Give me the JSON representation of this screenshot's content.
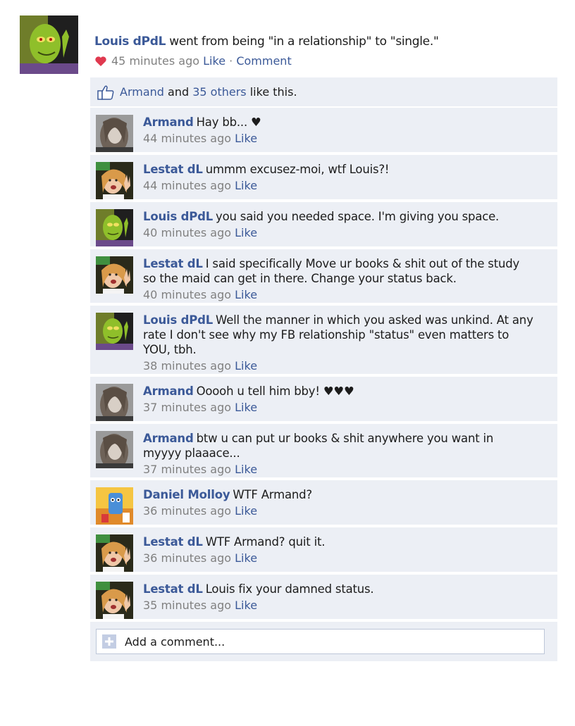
{
  "post": {
    "author": "Louis dPdL",
    "text": "went from being \"in a relationship\" to \"single.\"",
    "time": "45 minutes ago",
    "like_label": "Like",
    "separator": "·",
    "comment_label": "Comment"
  },
  "likes": {
    "first_name": "Armand",
    "and": "and",
    "others": "35 others",
    "suffix": "like this."
  },
  "comments": [
    {
      "author": "Armand",
      "text": "Hay bb... ♥",
      "time": "44 minutes ago",
      "like": "Like",
      "avatar": "armand"
    },
    {
      "author": "Lestat dL",
      "text": "ummm excusez-moi, wtf Louis?!",
      "time": "44 minutes ago",
      "like": "Like",
      "avatar": "lestat"
    },
    {
      "author": "Louis dPdL",
      "text": "you said you needed space. I'm giving you space.",
      "time": "40 minutes ago",
      "like": "Like",
      "avatar": "louis"
    },
    {
      "author": "Lestat dL",
      "text": "I said specifically Move ur books & shit out of the study so the maid can get in there. Change your status back.",
      "time": "40 minutes ago",
      "like": "Like",
      "avatar": "lestat"
    },
    {
      "author": "Louis dPdL",
      "text": "Well the manner in which you asked was unkind. At any rate I don't see why my FB relationship \"status\" even matters to YOU, tbh.",
      "time": "38 minutes ago",
      "like": "Like",
      "avatar": "louis"
    },
    {
      "author": "Armand",
      "text": "Ooooh u tell him bby! ♥♥♥",
      "time": "37 minutes ago",
      "like": "Like",
      "avatar": "armand"
    },
    {
      "author": "Armand",
      "text": "btw u can put ur books & shit anywhere you want in myyyy plaaace...",
      "time": "37 minutes ago",
      "like": "Like",
      "avatar": "armand"
    },
    {
      "author": "Daniel Molloy",
      "text": "WTF Armand?",
      "time": "36 minutes ago",
      "like": "Like",
      "avatar": "daniel"
    },
    {
      "author": "Lestat dL",
      "text": "WTF Armand? quit it.",
      "time": "36 minutes ago",
      "like": "Like",
      "avatar": "lestat"
    },
    {
      "author": "Lestat dL",
      "text": "Louis fix your damned status.",
      "time": "35 minutes ago",
      "like": "Like",
      "avatar": "lestat"
    }
  ],
  "add_comment": {
    "placeholder": "Add a comment..."
  },
  "colors": {
    "link": "#3b5998",
    "panel": "#eceff5",
    "meta": "#808080",
    "heart": "#e0394f"
  }
}
